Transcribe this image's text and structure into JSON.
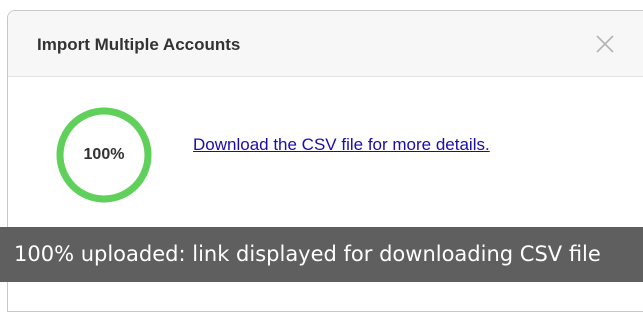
{
  "modal": {
    "title": "Import Multiple Accounts",
    "close_icon": "close-icon"
  },
  "progress": {
    "percent_text": "100%",
    "fraction": 1.0,
    "ring_color": "#5fd15a"
  },
  "download": {
    "link_text": "Download the CSV file for more details."
  },
  "caption": {
    "text": "100% uploaded: link displayed for downloading CSV file"
  },
  "colors": {
    "link": "#1a0dab",
    "caption_bg": "#5f5f5f",
    "header_bg": "#f7f7f7"
  }
}
